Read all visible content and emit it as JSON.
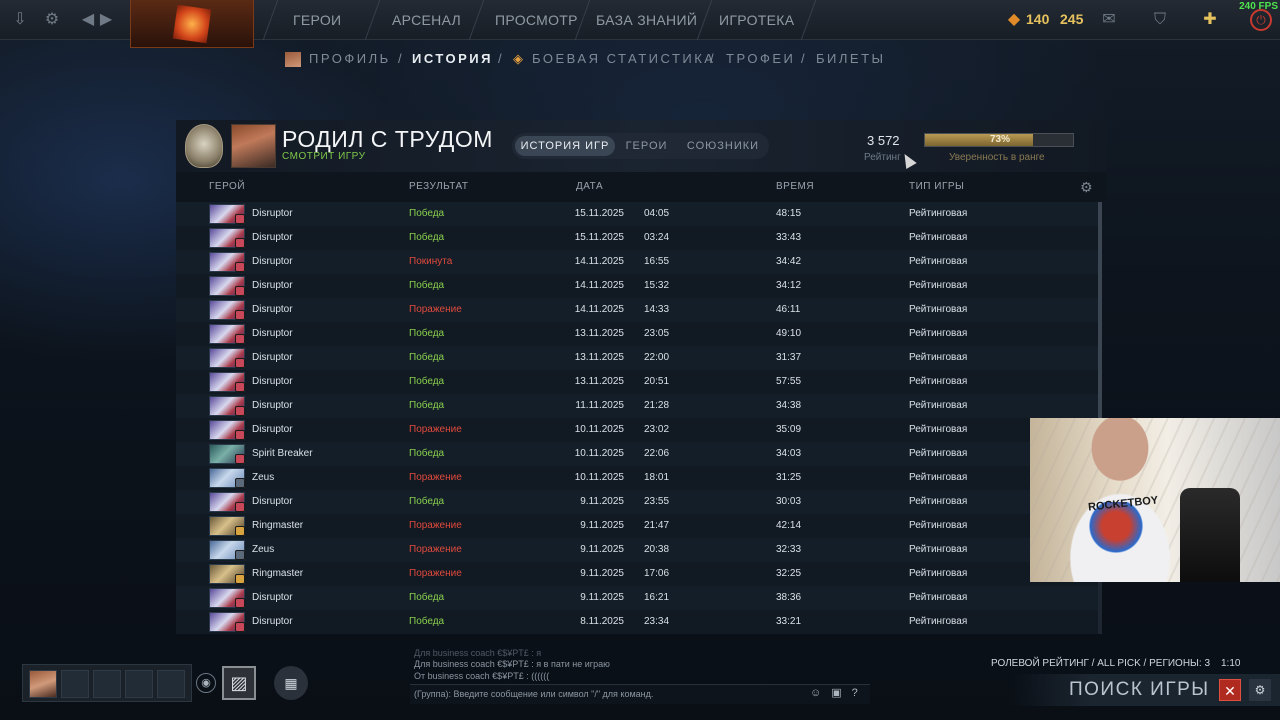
{
  "topnav": {
    "items": [
      "ГЕРОИ",
      "АРСЕНАЛ",
      "ПРОСМОТР",
      "БАЗА ЗНАНИЙ",
      "ИГРОТЕКА"
    ],
    "shards": "140",
    "plus_points": "245",
    "fps": "240 FPS"
  },
  "subnav": {
    "items": [
      "ПРОФИЛЬ",
      "ИСТОРИЯ",
      "БОЕВАЯ СТАТИСТИКА",
      "ТРОФЕИ",
      "БИЛЕТЫ"
    ],
    "separator": "/",
    "active_index": 1
  },
  "profile": {
    "name": "РОДИЛ С ТРУДОМ",
    "status": "СМОТРИТ ИГРУ",
    "tabs": [
      "ИСТОРИЯ ИГР",
      "ГЕРОИ",
      "СОЮЗНИКИ"
    ],
    "rating_value": "3 572",
    "rating_label": "Рейтинг",
    "confidence_percent": 73,
    "confidence_text": "73%",
    "confidence_label": "Уверенность в ранге"
  },
  "table": {
    "headers": [
      "ГЕРОЙ",
      "РЕЗУЛЬТАТ",
      "ДАТА",
      "ВРЕМЯ",
      "ТИП ИГРЫ"
    ],
    "rows": [
      {
        "hero": "Disruptor",
        "result": "Победа",
        "date": "15.11.2025",
        "time": "04:05",
        "duration": "48:15",
        "type": "Рейтинговая"
      },
      {
        "hero": "Disruptor",
        "result": "Победа",
        "date": "15.11.2025",
        "time": "03:24",
        "duration": "33:43",
        "type": "Рейтинговая"
      },
      {
        "hero": "Disruptor",
        "result": "Покинута",
        "date": "14.11.2025",
        "time": "16:55",
        "duration": "34:42",
        "type": "Рейтинговая"
      },
      {
        "hero": "Disruptor",
        "result": "Победа",
        "date": "14.11.2025",
        "time": "15:32",
        "duration": "34:12",
        "type": "Рейтинговая"
      },
      {
        "hero": "Disruptor",
        "result": "Поражение",
        "date": "14.11.2025",
        "time": "14:33",
        "duration": "46:11",
        "type": "Рейтинговая"
      },
      {
        "hero": "Disruptor",
        "result": "Победа",
        "date": "13.11.2025",
        "time": "23:05",
        "duration": "49:10",
        "type": "Рейтинговая"
      },
      {
        "hero": "Disruptor",
        "result": "Победа",
        "date": "13.11.2025",
        "time": "22:00",
        "duration": "31:37",
        "type": "Рейтинговая"
      },
      {
        "hero": "Disruptor",
        "result": "Победа",
        "date": "13.11.2025",
        "time": "20:51",
        "duration": "57:55",
        "type": "Рейтинговая"
      },
      {
        "hero": "Disruptor",
        "result": "Победа",
        "date": "11.11.2025",
        "time": "21:28",
        "duration": "34:38",
        "type": "Рейтинговая"
      },
      {
        "hero": "Disruptor",
        "result": "Поражение",
        "date": "10.11.2025",
        "time": "23:02",
        "duration": "35:09",
        "type": "Рейтинговая"
      },
      {
        "hero": "Spirit Breaker",
        "result": "Победа",
        "date": "10.11.2025",
        "time": "22:06",
        "duration": "34:03",
        "type": "Рейтинговая"
      },
      {
        "hero": "Zeus",
        "result": "Поражение",
        "date": "10.11.2025",
        "time": "18:01",
        "duration": "31:25",
        "type": "Рейтинговая"
      },
      {
        "hero": "Disruptor",
        "result": "Победа",
        "date": "9.11.2025",
        "time": "23:55",
        "duration": "30:03",
        "type": "Рейтинговая"
      },
      {
        "hero": "Ringmaster",
        "result": "Поражение",
        "date": "9.11.2025",
        "time": "21:47",
        "duration": "42:14",
        "type": "Рейтинговая"
      },
      {
        "hero": "Zeus",
        "result": "Поражение",
        "date": "9.11.2025",
        "time": "20:38",
        "duration": "32:33",
        "type": "Рейтинговая"
      },
      {
        "hero": "Ringmaster",
        "result": "Поражение",
        "date": "9.11.2025",
        "time": "17:06",
        "duration": "32:25",
        "type": "Рейтинговая"
      },
      {
        "hero": "Disruptor",
        "result": "Победа",
        "date": "9.11.2025",
        "time": "16:21",
        "duration": "38:36",
        "type": "Рейтинговая"
      },
      {
        "hero": "Disruptor",
        "result": "Победа",
        "date": "8.11.2025",
        "time": "23:34",
        "duration": "33:21",
        "type": "Рейтинговая"
      }
    ]
  },
  "webcam": {
    "shirt_text": "ROCKETBOY"
  },
  "chat": {
    "lines": [
      {
        "prefix": "Для",
        "text": "business coach €$¥PT£ : я",
        "faint": true
      },
      {
        "prefix": "Для",
        "text": "business coach €$¥PT£ : я в пати не играю",
        "faint": false
      },
      {
        "prefix": "От",
        "text": "business coach €$¥PT£ : ((((((",
        "faint": false
      }
    ],
    "input_placeholder": "(Группа): Введите сообщение или символ \"/\" для команд."
  },
  "matchmaking": {
    "info": "РОЛЕВОЙ РЕЙТИНГ / ALL PICK / РЕГИОНЫ: 3",
    "timer": "1:10",
    "search_label": "ПОИСК ИГРЫ"
  },
  "colors": {
    "win": "#8ad04e",
    "loss": "#e04a3c",
    "accent_gold": "#e6c25e",
    "cancel_red": "#b12a20"
  }
}
